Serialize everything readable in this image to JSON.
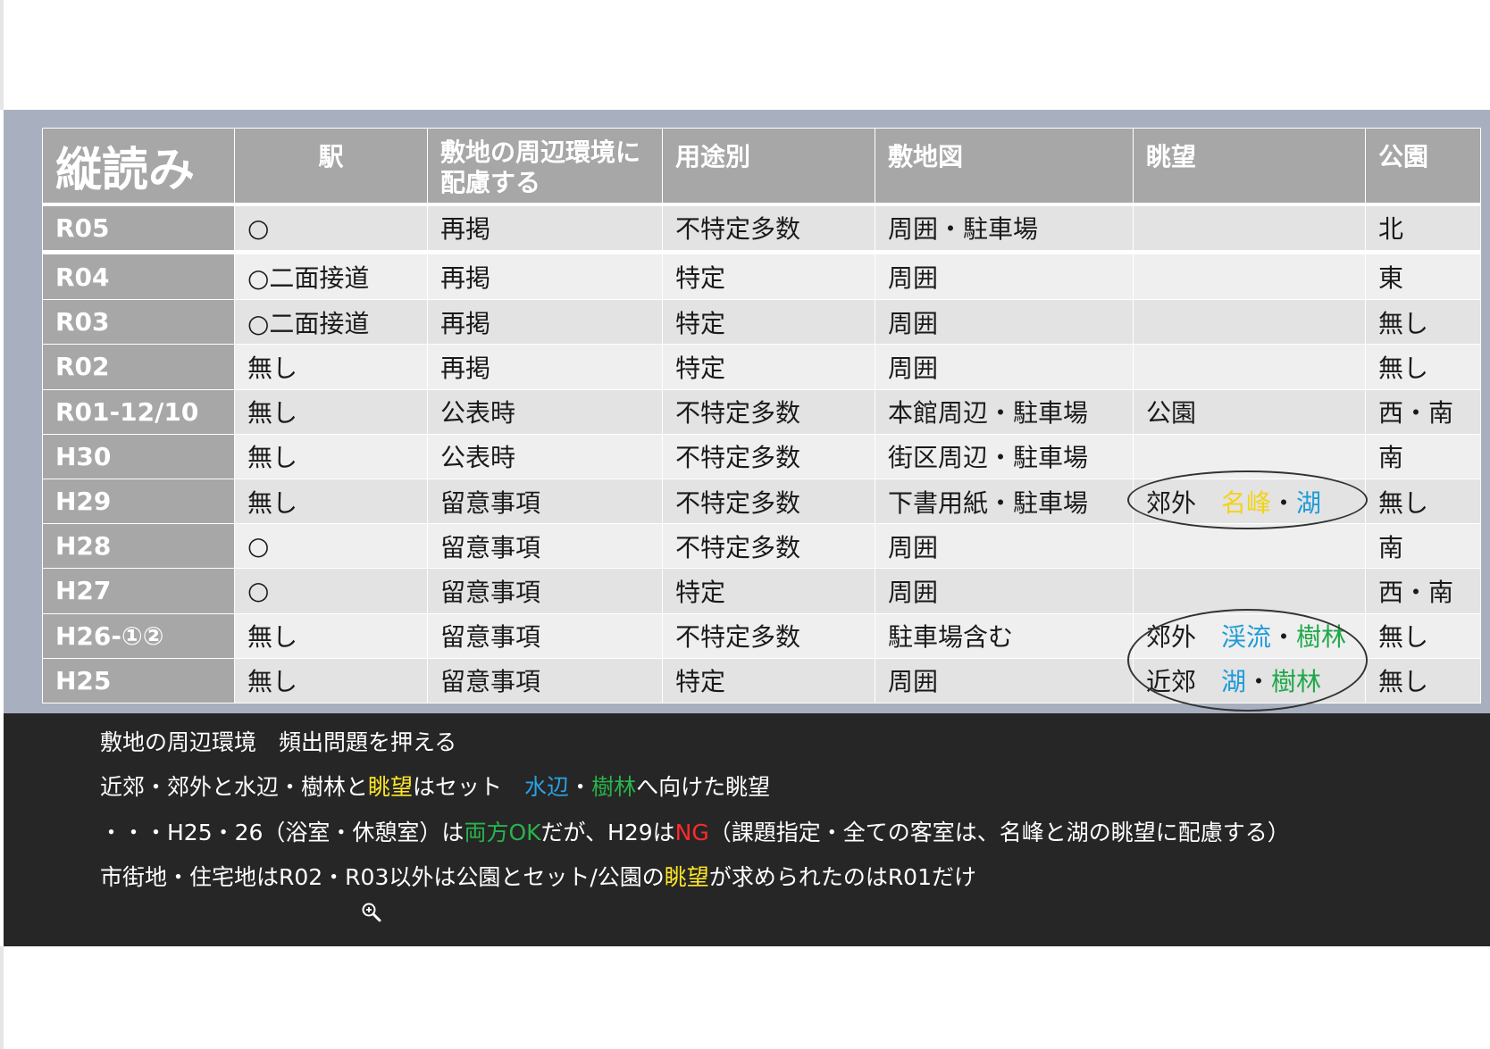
{
  "table": {
    "headers": [
      "縦読み",
      "駅",
      "敷地の周辺環境に配慮する",
      "用途別",
      "敷地図",
      "眺望",
      "公園"
    ],
    "rows": [
      {
        "year": "R05",
        "station": "○",
        "env": "再掲",
        "use": "不特定多数",
        "site": "周囲・駐車場",
        "view": [],
        "park": "北"
      },
      {
        "year": "R04",
        "station": "○二面接道",
        "env": "再掲",
        "use": "特定",
        "site": "周囲",
        "view": [],
        "park": "東"
      },
      {
        "year": "R03",
        "station": "○二面接道",
        "env": "再掲",
        "use": "特定",
        "site": "周囲",
        "view": [],
        "park": "無し"
      },
      {
        "year": "R02",
        "station": "無し",
        "env": "再掲",
        "use": "特定",
        "site": "周囲",
        "view": [],
        "park": "無し"
      },
      {
        "year": "R01-12/10",
        "station": "無し",
        "env": "公表時",
        "use": "不特定多数",
        "site": "本館周辺・駐車場",
        "view": [
          {
            "text": "公園",
            "color": "dark"
          }
        ],
        "park": "西・南"
      },
      {
        "year": "H30",
        "station": "無し",
        "env": "公表時",
        "use": "不特定多数",
        "site": "街区周辺・駐車場",
        "view": [],
        "park": "南"
      },
      {
        "year": "H29",
        "station": "無し",
        "env": "留意事項",
        "use": "不特定多数",
        "site": "下書用紙・駐車場",
        "view": [
          {
            "text": "郊外　",
            "color": "dark"
          },
          {
            "text": "名峰",
            "color": "yellow"
          },
          {
            "text": "・",
            "color": "dark"
          },
          {
            "text": "湖",
            "color": "blue"
          }
        ],
        "park": "無し"
      },
      {
        "year": "H28",
        "station": "○",
        "env": "留意事項",
        "use": "不特定多数",
        "site": "周囲",
        "view": [],
        "park": "南"
      },
      {
        "year": "H27",
        "station": "○",
        "env": "留意事項",
        "use": "特定",
        "site": "周囲",
        "view": [],
        "park": "西・南"
      },
      {
        "year": "H26-①②",
        "station": "無し",
        "env": "留意事項",
        "use": "不特定多数",
        "site": "駐車場含む",
        "view": [
          {
            "text": "郊外　",
            "color": "dark"
          },
          {
            "text": "渓流",
            "color": "blue"
          },
          {
            "text": "・",
            "color": "dark"
          },
          {
            "text": "樹林",
            "color": "green"
          }
        ],
        "park": "無し"
      },
      {
        "year": "H25",
        "station": "無し",
        "env": "留意事項",
        "use": "特定",
        "site": "周囲",
        "view": [
          {
            "text": "近郊　",
            "color": "dark"
          },
          {
            "text": "湖",
            "color": "blue"
          },
          {
            "text": "・",
            "color": "dark"
          },
          {
            "text": "樹林",
            "color": "green"
          }
        ],
        "park": "無し"
      }
    ]
  },
  "notes": [
    [
      {
        "text": "敷地の周辺環境　頻出問題を押える",
        "color": "white"
      }
    ],
    [
      {
        "text": "近郊・郊外と水辺・樹林と",
        "color": "white"
      },
      {
        "text": "眺望",
        "color": "yellow"
      },
      {
        "text": "はセット　",
        "color": "white"
      },
      {
        "text": "水辺",
        "color": "blue"
      },
      {
        "text": "・",
        "color": "white"
      },
      {
        "text": "樹林",
        "color": "green"
      },
      {
        "text": "へ向けた眺望",
        "color": "white"
      }
    ],
    [
      {
        "text": "・・・H25・26（浴室・休憩室）は",
        "color": "white"
      },
      {
        "text": "両方OK",
        "color": "green"
      },
      {
        "text": "だが、H29は",
        "color": "white"
      },
      {
        "text": "NG",
        "color": "red"
      },
      {
        "text": "（課題指定・全ての客室は、名峰と湖の眺望に配慮する）",
        "color": "white"
      }
    ],
    [
      {
        "text": "市街地・住宅地はR02・R03以外は公園とセット/公園の",
        "color": "white"
      },
      {
        "text": "眺望",
        "color": "yellow"
      },
      {
        "text": "が求められたのはR01だけ",
        "color": "white"
      }
    ]
  ],
  "icons": {
    "cursor": "zoom-in-icon"
  }
}
